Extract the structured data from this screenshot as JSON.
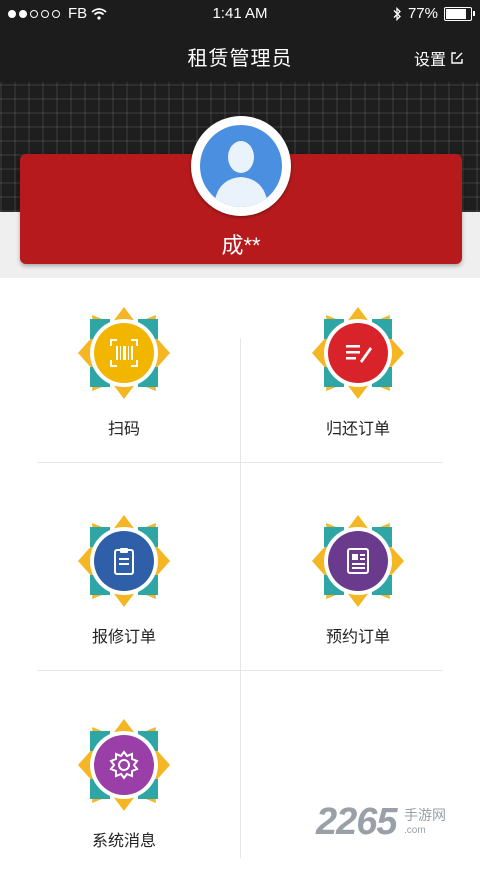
{
  "status_bar": {
    "carrier": "FB",
    "time": "1:41 AM",
    "battery": "77%",
    "battery_level": 0.77
  },
  "navbar": {
    "title": "租赁管理员",
    "settings_label": "设置"
  },
  "profile": {
    "name": "成**"
  },
  "menu": [
    {
      "label": "扫码",
      "icon": "barcode-scan-icon",
      "color": "#f2b600"
    },
    {
      "label": "归还订单",
      "icon": "edit-list-icon",
      "color": "#d9232a"
    },
    {
      "label": "报修订单",
      "icon": "clipboard-icon",
      "color": "#2f5fa8"
    },
    {
      "label": "预约订单",
      "icon": "document-icon",
      "color": "#6a3a8c"
    },
    {
      "label": "系统消息",
      "icon": "gear-icon",
      "color": "#9b3fa8"
    }
  ],
  "watermark": {
    "number": "2265",
    "text": "手游网",
    "url": ".com"
  }
}
